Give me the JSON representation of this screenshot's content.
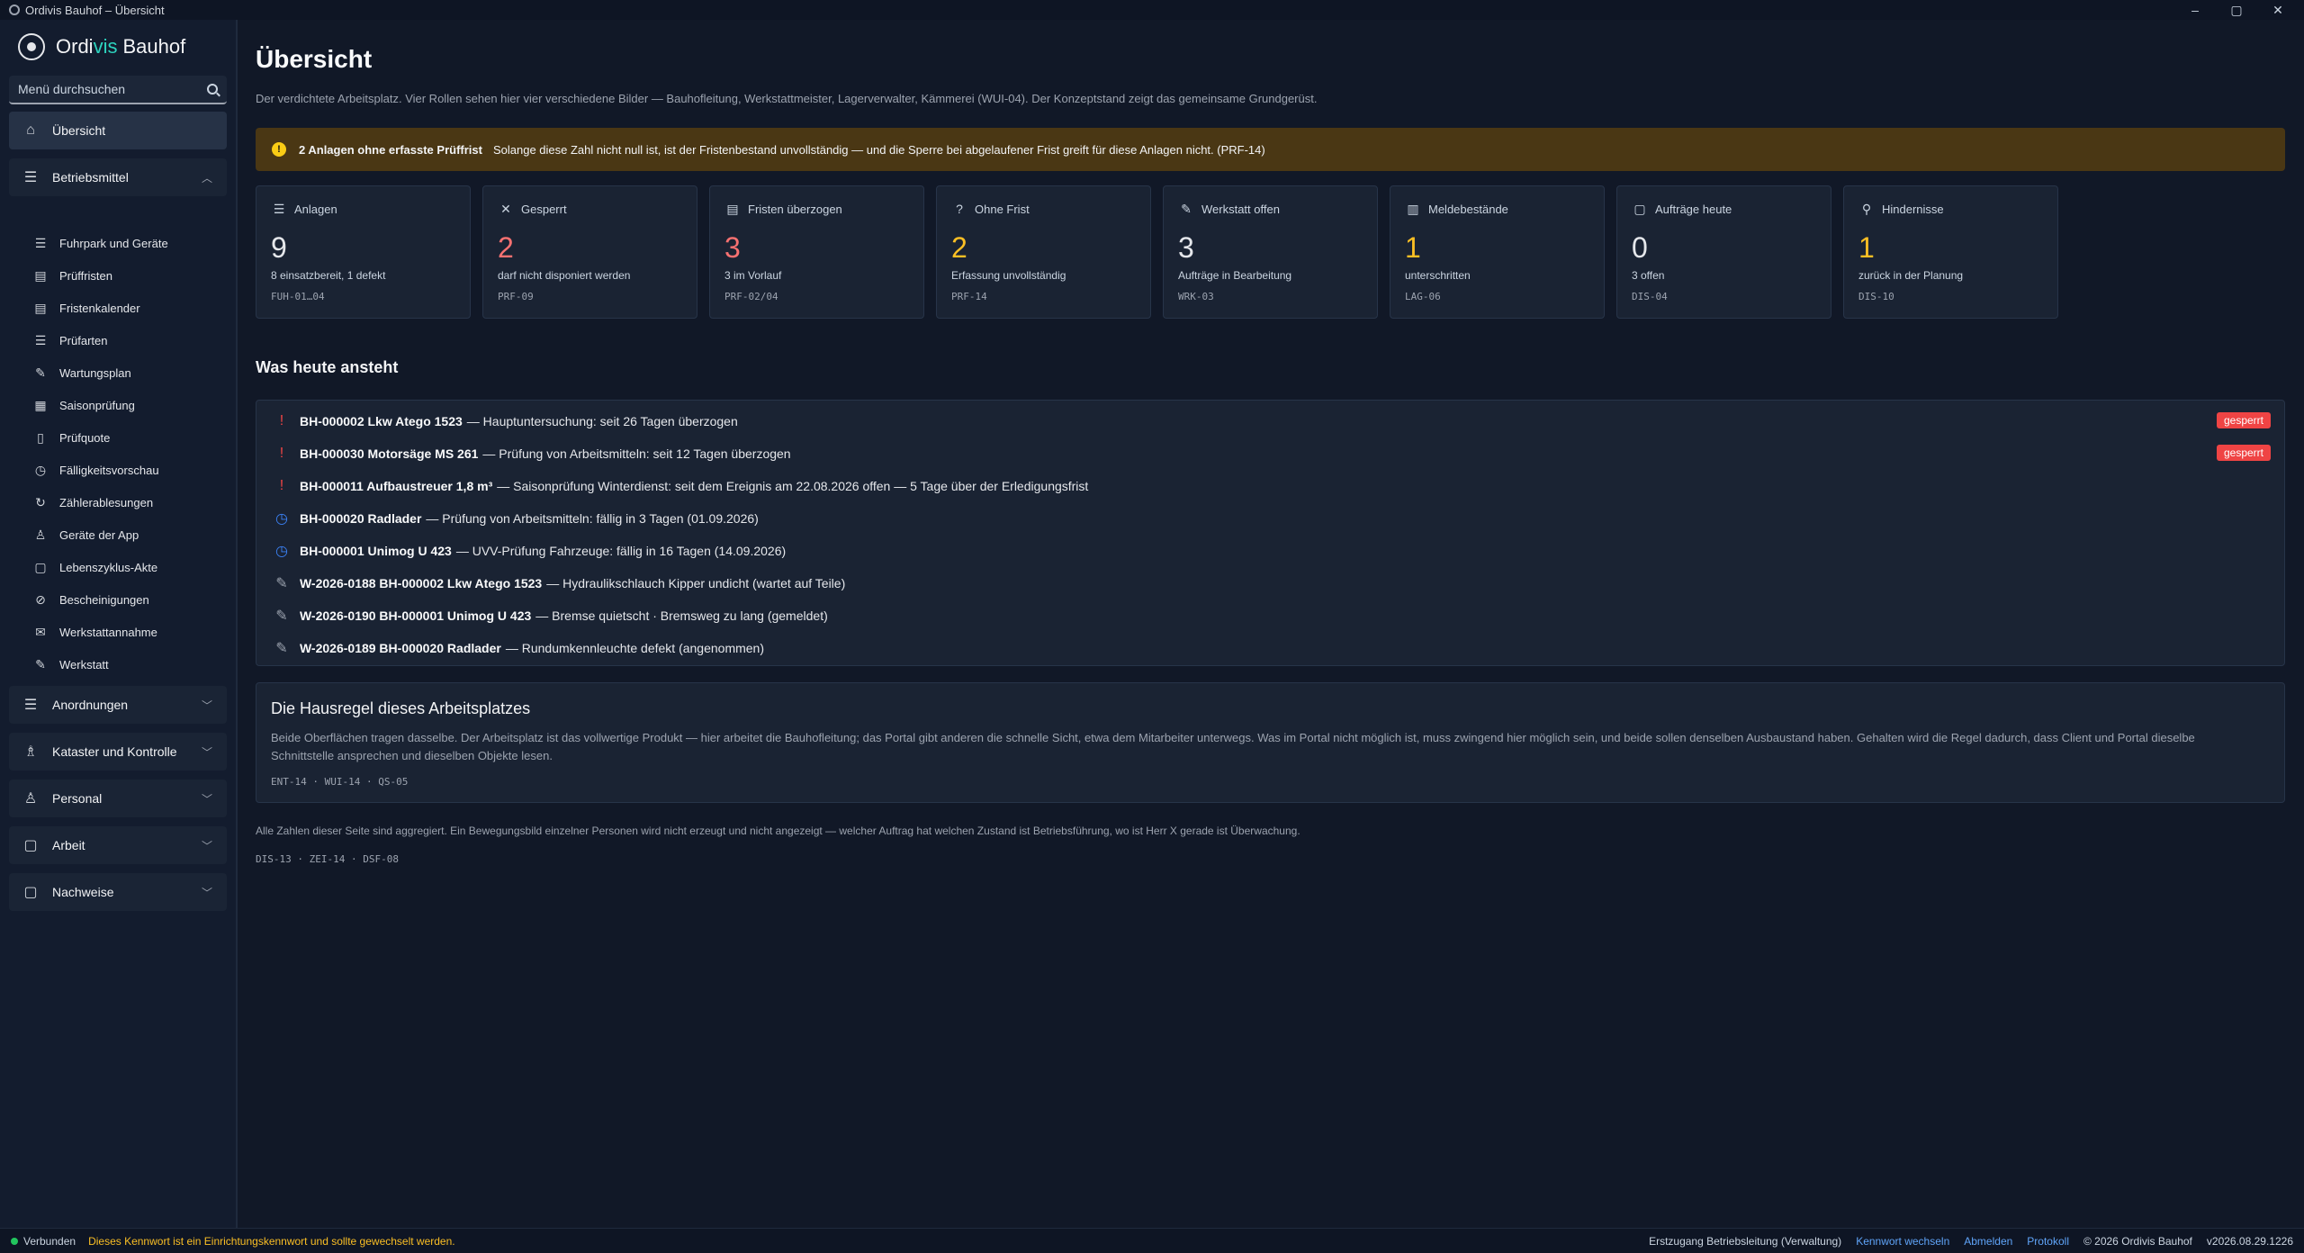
{
  "window": {
    "title": "Ordivis Bauhof – Übersicht",
    "controls": [
      "–",
      "▢",
      "✕"
    ]
  },
  "brand": {
    "part1": "Ordi",
    "part2": "vis",
    "part3": "Bauhof"
  },
  "search": {
    "placeholder": "Menü durchsuchen"
  },
  "nav": {
    "overview": "Übersicht",
    "groups": [
      {
        "label": "Betriebsmittel",
        "icon": "list-icon",
        "expanded": true
      },
      {
        "label": "Anordnungen",
        "icon": "list-icon",
        "expanded": false
      },
      {
        "label": "Kataster und Kontrolle",
        "icon": "inspector-icon",
        "expanded": false
      },
      {
        "label": "Personal",
        "icon": "person-icon",
        "expanded": false
      },
      {
        "label": "Arbeit",
        "icon": "document-icon",
        "expanded": false
      },
      {
        "label": "Nachweise",
        "icon": "document-icon",
        "expanded": false
      }
    ],
    "sub_items": [
      {
        "label": "Fuhrpark und Geräte",
        "icon": "list-icon"
      },
      {
        "label": "Prüffristen",
        "icon": "calendar-icon"
      },
      {
        "label": "Fristenkalender",
        "icon": "calendar-icon"
      },
      {
        "label": "Prüfarten",
        "icon": "list-icon"
      },
      {
        "label": "Wartungsplan",
        "icon": "wrench-icon"
      },
      {
        "label": "Saisonprüfung",
        "icon": "calendar-check-icon"
      },
      {
        "label": "Prüfquote",
        "icon": "bar-icon"
      },
      {
        "label": "Fälligkeitsvorschau",
        "icon": "clock-icon"
      },
      {
        "label": "Zählerablesungen",
        "icon": "refresh-icon"
      },
      {
        "label": "Geräte der App",
        "icon": "person-icon"
      },
      {
        "label": "Lebenszyklus-Akte",
        "icon": "document-icon"
      },
      {
        "label": "Bescheinigungen",
        "icon": "link-icon"
      },
      {
        "label": "Werkstattannahme",
        "icon": "mail-icon"
      },
      {
        "label": "Werkstatt",
        "icon": "wrench-icon"
      }
    ]
  },
  "main": {
    "title": "Übersicht",
    "subtitle": "Der verdichtete Arbeitsplatz. Vier Rollen sehen hier vier verschiedene Bilder — Bauhofleitung, Werkstattmeister, Lagerverwalter, Kämmerei (WUI-04). Der Konzeptstand zeigt das gemeinsame Grundgerüst.",
    "warning": {
      "title": "2 Anlagen ohne erfasste Prüffrist",
      "text": "Solange diese Zahl nicht null ist, ist der Fristenbestand unvollständig — und die Sperre bei abgelaufener Frist greift für diese Anlagen nicht. (PRF-14)"
    },
    "cards": [
      {
        "label": "Anlagen",
        "icon": "list-icon",
        "value": "9",
        "color": "#e5e7eb",
        "desc": "8 einsatzbereit, 1 defekt",
        "code": "FUH-01…04"
      },
      {
        "label": "Gesperrt",
        "icon": "x-icon",
        "value": "2",
        "color": "#f87171",
        "desc": "darf nicht disponiert werden",
        "code": "PRF-09"
      },
      {
        "label": "Fristen überzogen",
        "icon": "calendar-icon",
        "value": "3",
        "color": "#f87171",
        "desc": "3 im Vorlauf",
        "code": "PRF-02/04"
      },
      {
        "label": "Ohne Frist",
        "icon": "question-icon",
        "value": "2",
        "color": "#fbbf24",
        "desc": "Erfassung unvollständig",
        "code": "PRF-14"
      },
      {
        "label": "Werkstatt offen",
        "icon": "wrench-icon",
        "value": "3",
        "color": "#e5e7eb",
        "desc": "Aufträge in Bearbeitung",
        "code": "WRK-03"
      },
      {
        "label": "Meldebestände",
        "icon": "bottle-icon",
        "value": "1",
        "color": "#fbbf24",
        "desc": "unterschritten",
        "code": "LAG-06"
      },
      {
        "label": "Aufträge heute",
        "icon": "document-icon",
        "value": "0",
        "color": "#e5e7eb",
        "desc": "3 offen",
        "code": "DIS-04"
      },
      {
        "label": "Hindernisse",
        "icon": "pin-icon",
        "value": "1",
        "color": "#fbbf24",
        "desc": "zurück in der Planung",
        "code": "DIS-10"
      }
    ],
    "due_title": "Was heute ansteht",
    "due_items": [
      {
        "icon": "exclamation-icon",
        "bold": "BH-000002 Lkw Atego 1523",
        "text": "— Hauptuntersuchung: seit 26 Tagen überzogen",
        "badge": "gesperrt"
      },
      {
        "icon": "exclamation-icon",
        "bold": "BH-000030 Motorsäge MS 261",
        "text": "— Prüfung von Arbeitsmitteln: seit 12 Tagen überzogen",
        "badge": "gesperrt"
      },
      {
        "icon": "exclamation-icon",
        "bold": "BH-000011 Aufbaustreuer 1,8 m³",
        "text": "— Saisonprüfung Winterdienst: seit dem Ereignis am 22.08.2026 offen — 5 Tage über der Erledigungsfrist",
        "badge": ""
      },
      {
        "icon": "clock-icon",
        "bold": "BH-000020 Radlader",
        "text": "— Prüfung von Arbeitsmitteln: fällig in 3 Tagen (01.09.2026)",
        "badge": ""
      },
      {
        "icon": "clock-icon",
        "bold": "BH-000001 Unimog U 423",
        "text": "— UVV-Prüfung Fahrzeuge: fällig in 16 Tagen (14.09.2026)",
        "badge": ""
      },
      {
        "icon": "wrench-icon",
        "bold": "W-2026-0188 BH-000002 Lkw Atego 1523",
        "text": "— Hydraulikschlauch Kipper undicht (wartet auf Teile)",
        "badge": ""
      },
      {
        "icon": "wrench-icon",
        "bold": "W-2026-0190 BH-000001 Unimog U 423",
        "text": "— Bremse quietscht · Bremsweg zu lang (gemeldet)",
        "badge": ""
      },
      {
        "icon": "wrench-icon",
        "bold": "W-2026-0189 BH-000020 Radlader",
        "text": "— Rundumkennleuchte defekt (angenommen)",
        "badge": ""
      }
    ],
    "rule": {
      "title": "Die Hausregel dieses Arbeitsplatzes",
      "text": "Beide Oberflächen tragen dasselbe. Der Arbeitsplatz ist das vollwertige Produkt — hier arbeitet die Bauhofleitung; das Portal gibt anderen die schnelle Sicht, etwa dem Mitarbeiter unterwegs. Was im Portal nicht möglich ist, muss zwingend hier möglich sein, und beide sollen denselben Ausbaustand haben. Gehalten wird die Regel dadurch, dass Client und Portal dieselbe Schnittstelle ansprechen und dieselben Objekte lesen.",
      "codes": "ENT-14 · WUI-14 · QS-05"
    },
    "footnote": "Alle Zahlen dieser Seite sind aggregiert. Ein Bewegungsbild einzelner Personen wird nicht erzeugt und nicht angezeigt — welcher Auftrag hat welchen Zustand ist Betriebsführung, wo ist Herr X gerade ist Überwachung.",
    "footcodes": "DIS-13 · ZEI-14 · DSF-08"
  },
  "status": {
    "connected": "Verbunden",
    "pw_warning": "Dieses Kennwort ist ein Einrichtungskennwort und sollte gewechselt werden.",
    "user": "Erstzugang Betriebsleitung (Verwaltung)",
    "change_pw": "Kennwort wechseln",
    "logout": "Abmelden",
    "protocol": "Protokoll",
    "copyright": "© 2026 Ordivis Bauhof",
    "version": "v2026.08.29.1226"
  },
  "colors": {
    "background": "#111827",
    "panel": "#1a2333",
    "accent": "#2dd4bf",
    "danger": "#ef4444",
    "warning": "#fbbf24",
    "info": "#3b82f6"
  }
}
